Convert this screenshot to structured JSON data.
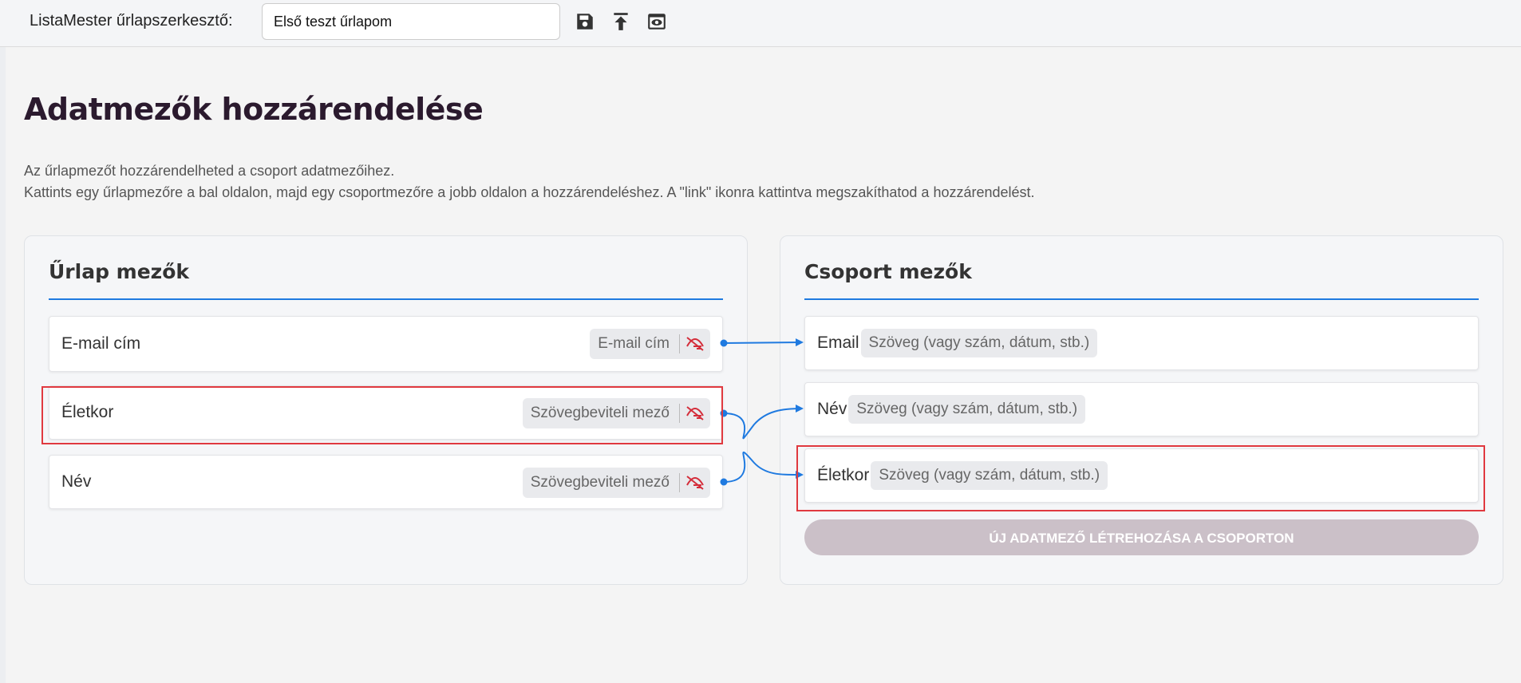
{
  "topbar": {
    "app_title": "ListaMester űrlapszerkesztő:",
    "form_title_value": "Első teszt űrlapom",
    "icons": [
      "save-icon",
      "upload-icon",
      "preview-eye-icon"
    ]
  },
  "page": {
    "title": "Adatmezők hozzárendelése",
    "description_line1": "Az űrlapmezőt hozzárendelheted a csoport adatmezőihez.",
    "description_line2": "Kattints egy űrlapmezőre a bal oldalon, majd egy csoportmezőre a jobb oldalon a hozzárendeléshez. A \"link\" ikonra kattintva megszakíthatod a hozzárendelést."
  },
  "form_panel": {
    "heading": "Űrlap mezők",
    "fields": [
      {
        "label": "E-mail cím",
        "type": "E-mail cím",
        "icon": "unlink-icon",
        "linked_to": "Email"
      },
      {
        "label": "Életkor",
        "type": "Szövegbeviteli mező",
        "icon": "unlink-icon",
        "linked_to": "Név"
      },
      {
        "label": "Név",
        "type": "Szövegbeviteli mező",
        "icon": "unlink-icon",
        "linked_to": "Életkor"
      }
    ]
  },
  "group_panel": {
    "heading": "Csoport mezők",
    "fields": [
      {
        "label": "Email",
        "type": "Szöveg (vagy szám, dátum, stb.)"
      },
      {
        "label": "Név",
        "type": "Szöveg (vagy szám, dátum, stb.)"
      },
      {
        "label": "Életkor",
        "type": "Szöveg (vagy szám, dátum, stb.)"
      }
    ],
    "create_button": "ÚJ ADATMEZŐ LÉTREHOZÁSA A CSOPORTON"
  },
  "colors": {
    "accent": "#1f7ae0",
    "title": "#2b1a2e",
    "unlink_icon": "#d42d3a",
    "highlight": "#e0393f",
    "disabled_button": "#cbc0c8"
  }
}
